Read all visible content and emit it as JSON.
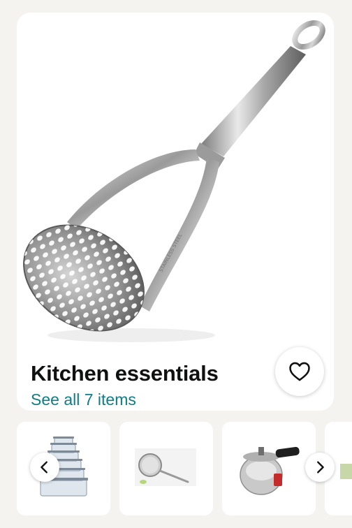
{
  "collection": {
    "title": "Kitchen essentials",
    "see_all_label": "See all 7 items",
    "hero_icon": "potato-masher-image",
    "favorite_icon": "heart-icon"
  },
  "hero_engraving": "STAINLESS STEEL",
  "thumbnails": [
    {
      "name": "storage-containers",
      "icon": "container-set-image"
    },
    {
      "name": "strainer",
      "icon": "strainer-image"
    },
    {
      "name": "pressure-cooker",
      "icon": "pressure-cooker-image"
    },
    {
      "name": "partial-item",
      "icon": "product-image"
    }
  ],
  "carousel": {
    "prev_icon": "chevron-left-icon",
    "next_icon": "chevron-right-icon"
  },
  "colors": {
    "background": "#f4f3ef",
    "link": "#0f7d85",
    "title": "#0f1111"
  }
}
